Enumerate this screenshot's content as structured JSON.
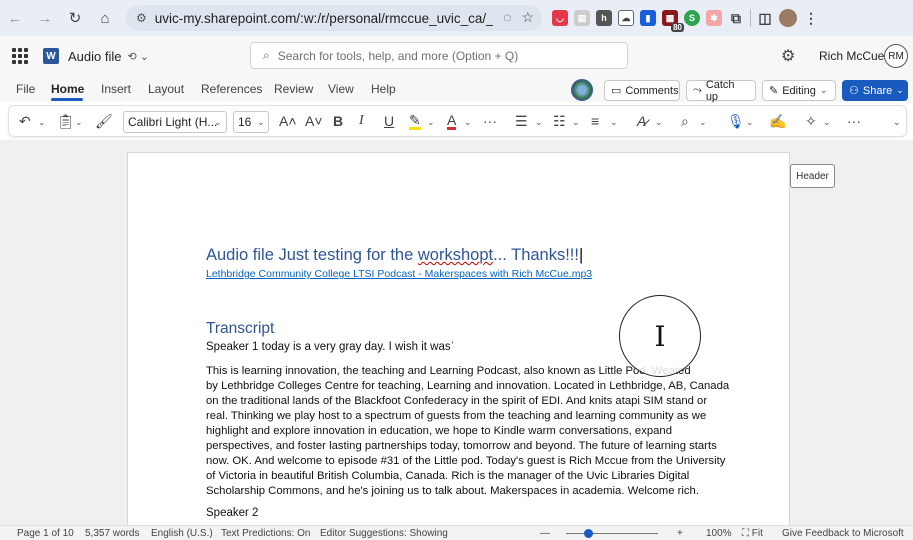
{
  "browser": {
    "url": "uvic-my.sharepoint.com/:w:/r/personal/rmccue_uvic_ca/_la...",
    "extension_badges": [
      "80"
    ]
  },
  "app": {
    "doc_title": "Audio file",
    "search_placeholder": "Search for tools, help, and more (Option + Q)",
    "user_name": "Rich McCue",
    "user_initials": "RM"
  },
  "ribbon": {
    "tabs": [
      "File",
      "Home",
      "Insert",
      "Layout",
      "References",
      "Review",
      "View",
      "Help"
    ],
    "active_tab": "Home",
    "comments": "Comments",
    "catch_up": "Catch up",
    "editing": "Editing",
    "share": "Share"
  },
  "toolbar": {
    "font": "Calibri Light (H...",
    "size": "16"
  },
  "document": {
    "heading_pre": "Audio file Just testing for the ",
    "heading_word": "workshopt",
    "heading_post": "... Thanks!!!",
    "link": "Lethbridge Community College LTSI Podcast - Makerspaces with Rich McCue.mp3",
    "transcript_heading": "Transcript",
    "speaker1_line": "Speaker 1 today is a very gray day. I wish it was",
    "paragraph_lines": [
      "This is learning innovation, the teaching and Learning Podcast, also known as Little Pod. W",
      "by Lethbridge Colleges Centre for teaching, Learning and innovation. Located in Lethbridge, AB, Canada",
      "on the traditional lands of the Blackfoot Confederacy in the spirit of EDI. And knits atapi SIM stand or",
      "real. Thinking we play host to a spectrum of guests from the teaching and learning community as we",
      "highlight and explore innovation in education, we hope to Kindle warm conversations, expand",
      "perspectives, and foster lasting partnerships today, tomorrow and beyond. The future of learning starts",
      "now. OK. And welcome to episode #31 of the Little pod. Today's guest is Rich Mccue from the University",
      "of Victoria in beautiful British Columbia, Canada. Rich is the manager of the Uvic Libraries Digital",
      "Scholarship Commons, and he's joining us to talk about. Makerspaces in academia. Welcome rich."
    ],
    "line1_tail": "eated",
    "speaker2": "Speaker 2",
    "header_tag": "Header"
  },
  "status": {
    "page": "Page 1 of 10",
    "words": "5,357 words",
    "language": "English (U.S.)",
    "text_predictions": "Text Predictions: On",
    "editor_suggestions": "Editor Suggestions: Showing",
    "zoom": "100%",
    "fit": "Fit",
    "feedback": "Give Feedback to Microsoft"
  },
  "colors": {
    "accent": "#185abd",
    "heading": "#2f5597",
    "link": "#0563c1"
  }
}
